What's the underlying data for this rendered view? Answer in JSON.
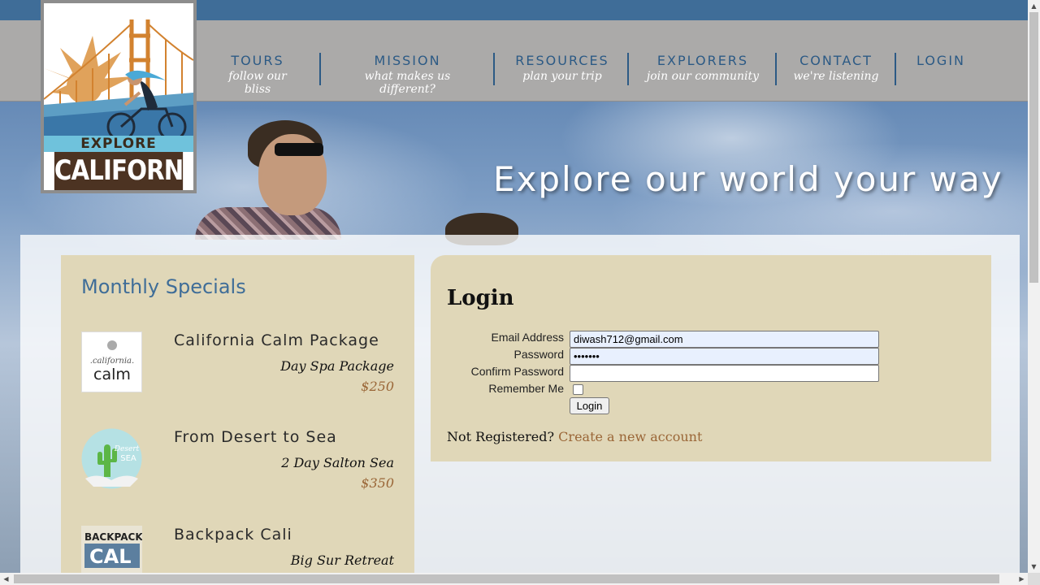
{
  "logo": {
    "line1": "EXPLORE",
    "line2": "CALIFORNIA"
  },
  "nav": [
    {
      "title": "TOURS",
      "sub": "follow our bliss"
    },
    {
      "title": "MISSION",
      "sub": "what makes us different?"
    },
    {
      "title": "RESOURCES",
      "sub": "plan your trip"
    },
    {
      "title": "EXPLORERS",
      "sub": "join our community"
    },
    {
      "title": "CONTACT",
      "sub": "we're listening"
    },
    {
      "title": "LOGIN",
      "sub": ""
    }
  ],
  "hero": {
    "tagline": "Explore our world your way"
  },
  "specials": {
    "heading": "Monthly Specials",
    "items": [
      {
        "name": "California Calm Package",
        "package": "Day Spa Package",
        "price": "$250",
        "thumb_text": "california calm"
      },
      {
        "name": "From Desert to Sea",
        "package": "2 Day Salton Sea",
        "price": "$350",
        "thumb_text": "Desert to Sea"
      },
      {
        "name": "Backpack Cali",
        "package": "Big Sur Retreat",
        "price": "",
        "thumb_text": "BACKPACK CAL"
      }
    ]
  },
  "login": {
    "heading": "Login",
    "email_label": "Email Address",
    "email_value": "diwash712@gmail.com",
    "password_label": "Password",
    "password_value": "•••••••",
    "confirm_label": "Confirm Password",
    "confirm_value": "",
    "remember_label": "Remember Me",
    "remember_checked": false,
    "button_label": "Login",
    "not_registered": "Not Registered?",
    "create_link": "Create a new account"
  },
  "colors": {
    "nav_title": "#2c5a85",
    "panel_bg": "#e0d7b8",
    "accent_brown": "#9a6637",
    "heading_blue": "#3f6d98"
  }
}
